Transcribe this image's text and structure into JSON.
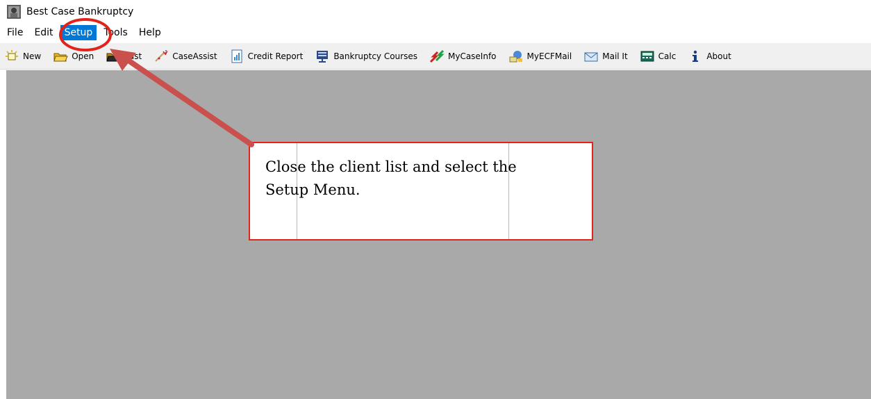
{
  "window": {
    "title": "Best Case Bankruptcy"
  },
  "menubar": {
    "items": [
      {
        "label": "File"
      },
      {
        "label": "Edit"
      },
      {
        "label": "Setup",
        "active": true
      },
      {
        "label": "Tools"
      },
      {
        "label": "Help"
      }
    ]
  },
  "toolbar": {
    "buttons": [
      {
        "label": "New",
        "icon": "new-icon"
      },
      {
        "label": "Open",
        "icon": "open-folder-icon"
      },
      {
        "label": "Last",
        "icon": "last-folder-icon"
      },
      {
        "label": "CaseAssist",
        "icon": "caseassist-icon"
      },
      {
        "label": "Credit Report",
        "icon": "credit-report-icon"
      },
      {
        "label": "Bankruptcy Courses",
        "icon": "courses-icon"
      },
      {
        "label": "MyCaseInfo",
        "icon": "mycaseinfo-icon"
      },
      {
        "label": "MyECFMail",
        "icon": "myecfmail-icon"
      },
      {
        "label": "Mail It",
        "icon": "mail-icon"
      },
      {
        "label": "Calc",
        "icon": "calculator-icon"
      },
      {
        "label": "About",
        "icon": "info-icon"
      }
    ]
  },
  "annotation": {
    "text_line1": "Close the client list and select the",
    "text_line2": "Setup Menu."
  },
  "colors": {
    "menu_active": "#0078d7",
    "workspace": "#a9a9a9",
    "annotation_red": "#e2231a",
    "arrow": "#c9504c"
  }
}
